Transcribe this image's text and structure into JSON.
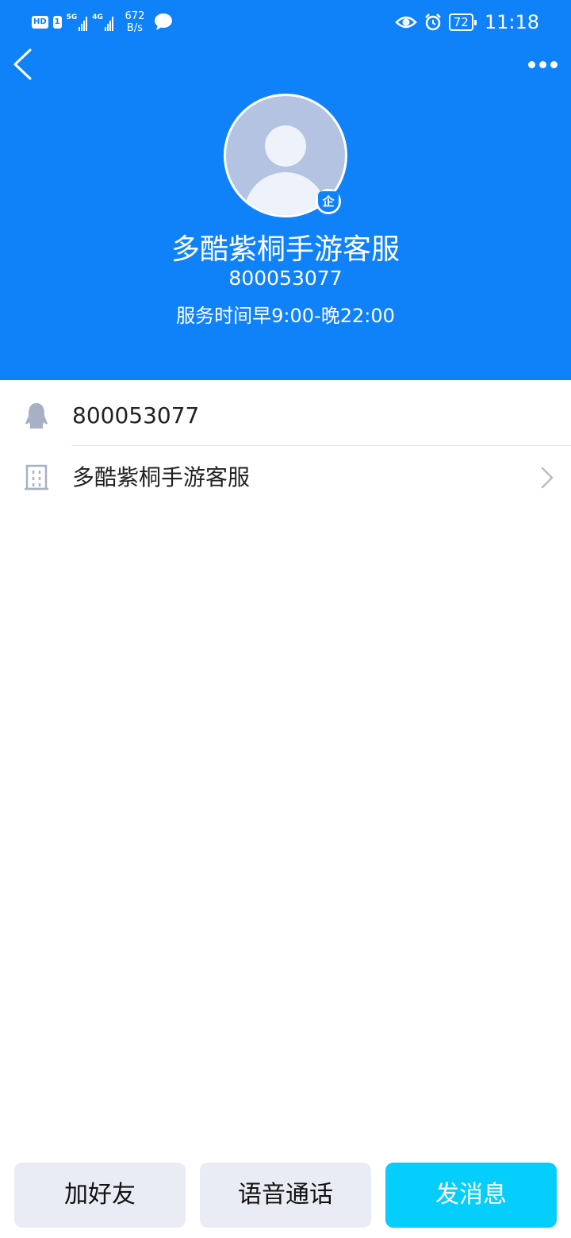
{
  "status_bar": {
    "hd_label": "HD",
    "sim_label": "1",
    "signal_5g": "5G",
    "signal_4g": "4G",
    "net_speed_value": "672",
    "net_speed_unit": "B/s",
    "battery": "72",
    "time": "11:18"
  },
  "header": {
    "back_icon": "chevron-left-icon",
    "more_icon": "more-dots-icon",
    "background_color": "#0f82fa"
  },
  "profile": {
    "avatar_icon": "default-avatar-icon",
    "enterprise_badge": "企",
    "name": "多酷紫桐手游客服",
    "number": "800053077",
    "service_hours": "服务时间早9:00-晚22:00"
  },
  "info": {
    "qq_number": "800053077",
    "company_name": "多酷紫桐手游客服"
  },
  "actions": {
    "add_friend": "加好友",
    "voice_call": "语音通话",
    "send_message": "发消息",
    "primary_color": "#06cefc"
  }
}
